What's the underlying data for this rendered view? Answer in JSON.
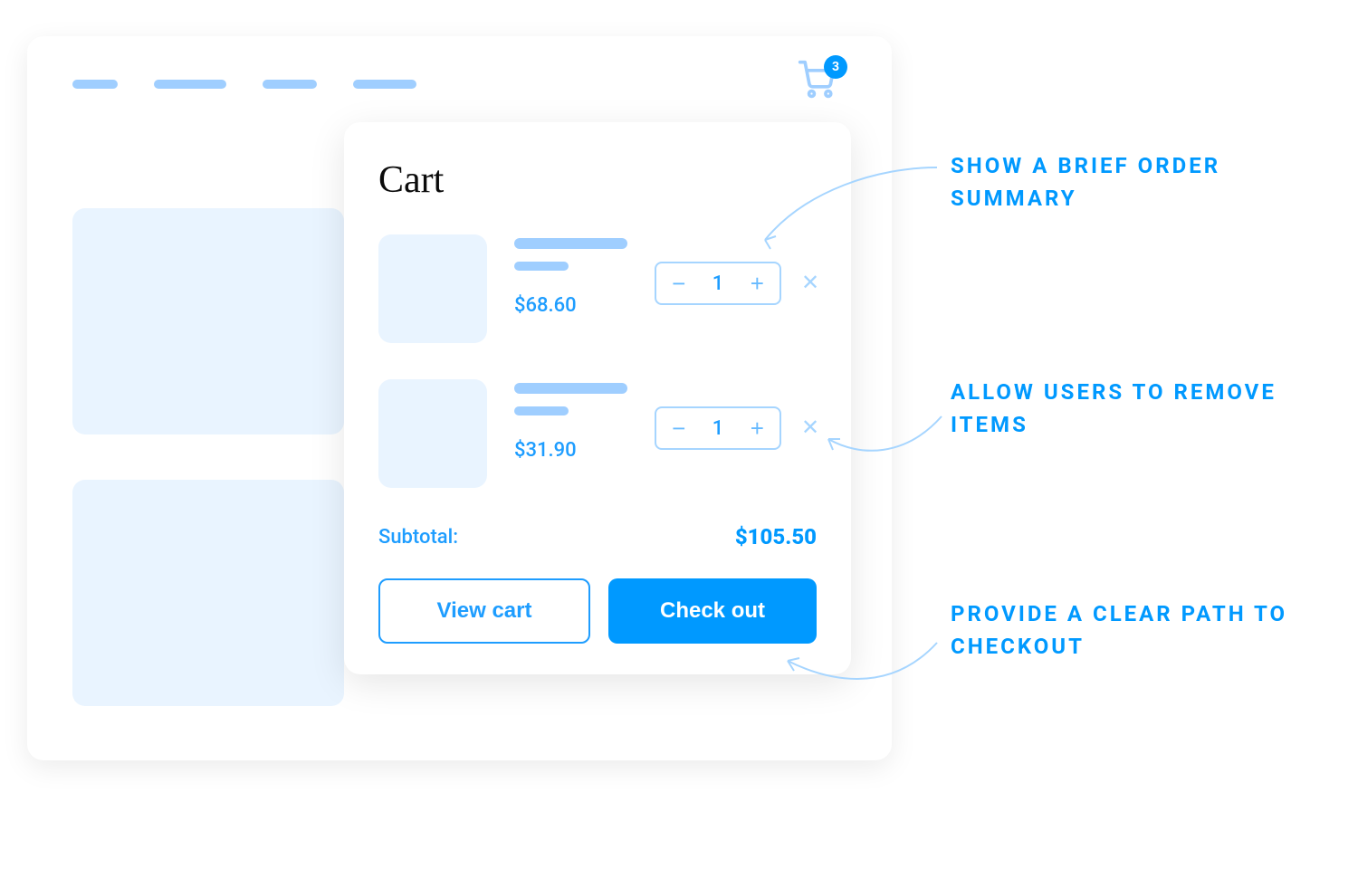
{
  "cart": {
    "badge_count": "3",
    "title": "Cart",
    "items": [
      {
        "price": "$68.60",
        "qty": "1"
      },
      {
        "price": "$31.90",
        "qty": "1"
      }
    ],
    "subtotal_label": "Subtotal:",
    "subtotal_value": "$105.50",
    "view_cart_label": "View cart",
    "checkout_label": "Check out"
  },
  "annotations": {
    "summary": "Show a brief order summary",
    "remove": "Allow users to remove items",
    "checkout": "Provide a clear path to checkout"
  }
}
